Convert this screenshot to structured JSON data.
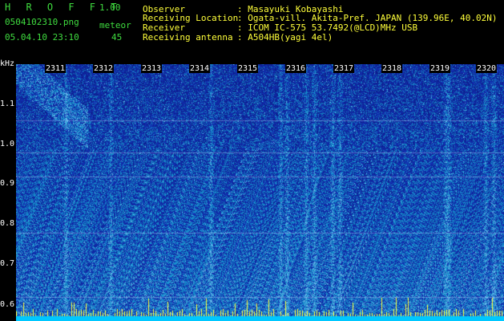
{
  "header": {
    "brand": "H R O F F T",
    "version": "1.00",
    "filename": "0504102310.png",
    "mode": "meteor",
    "datetime": "05.04.10 23:10",
    "count": "45",
    "fields": [
      {
        "label": "Observer",
        "value": ": Masayuki Kobayashi"
      },
      {
        "label": "Receiving Location",
        "value": ": Ogata-vill. Akita-Pref. JAPAN (139.96E, 40.02N)"
      },
      {
        "label": "Receiver",
        "value": ": ICOM IC-575 53.7492(@LCD)MHz USB"
      },
      {
        "label": "Receiving antenna",
        "value": ": A504HB(yagi 4el)"
      }
    ]
  },
  "axis": {
    "unit": "kHz",
    "ticks": [
      "1.1",
      "1.0",
      "0.9",
      "0.8",
      "0.7",
      "0.6"
    ]
  },
  "time_marks": [
    "2311",
    "2312",
    "2313",
    "2314",
    "2315",
    "2316",
    "2317",
    "2318",
    "2319",
    "2320"
  ],
  "colors": {
    "background": "#000000",
    "label_green": "#3fdc3f",
    "label_yellow": "#ffff3a",
    "spectrum_low": "#0a1a9a",
    "spectrum_high": "#2bd0a0",
    "bottom_trace": "#00c8ff"
  }
}
